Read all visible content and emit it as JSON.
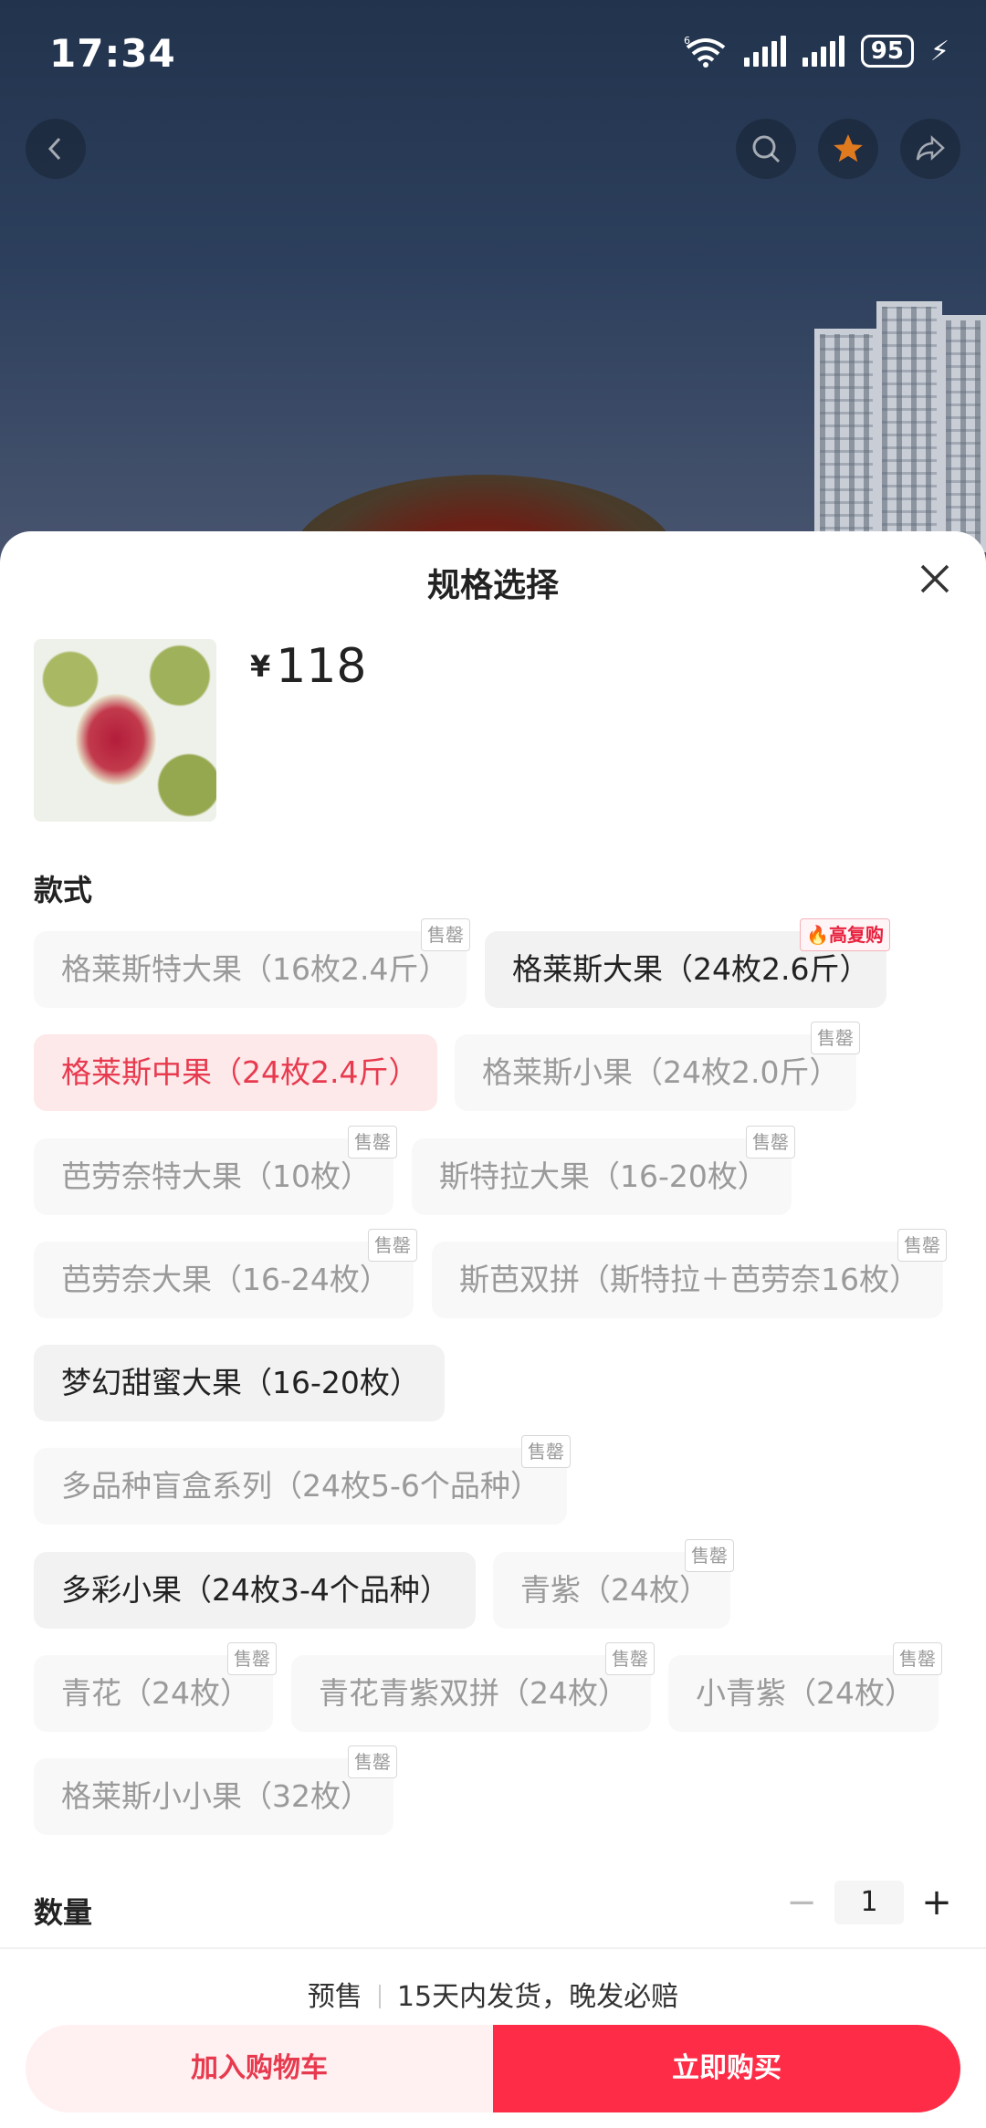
{
  "status_bar": {
    "time": "17:34",
    "battery": "95",
    "network": "6"
  },
  "sheet": {
    "title": "规格选择",
    "price_currency": "¥",
    "price": "118",
    "style_label": "款式",
    "quantity_label": "数量",
    "quantity_value": "1",
    "minus": "−",
    "plus": "+"
  },
  "options": [
    {
      "label": "格莱斯特大果（16枚2.4斤）",
      "state": "soldout",
      "tag": "售罄"
    },
    {
      "label": "格莱斯大果（24枚2.6斤）",
      "state": "available",
      "tag": "高复购"
    },
    {
      "label": "格莱斯中果（24枚2.4斤）",
      "state": "selected",
      "tag": ""
    },
    {
      "label": "格莱斯小果（24枚2.0斤）",
      "state": "soldout",
      "tag": "售罄"
    },
    {
      "label": "芭劳奈特大果（10枚）",
      "state": "soldout",
      "tag": "售罄"
    },
    {
      "label": "斯特拉大果（16-20枚）",
      "state": "soldout",
      "tag": "售罄"
    },
    {
      "label": "芭劳奈大果（16-24枚）",
      "state": "soldout",
      "tag": "售罄"
    },
    {
      "label": "斯芭双拼（斯特拉＋芭劳奈16枚）",
      "state": "soldout",
      "tag": "售罄"
    },
    {
      "label": "梦幻甜蜜大果（16-20枚）",
      "state": "available",
      "tag": ""
    },
    {
      "label": "多品种盲盒系列（24枚5-6个品种）",
      "state": "soldout",
      "tag": "售罄"
    },
    {
      "label": "多彩小果（24枚3-4个品种）",
      "state": "available",
      "tag": ""
    },
    {
      "label": "青紫（24枚）",
      "state": "soldout",
      "tag": "售罄"
    },
    {
      "label": "青花（24枚）",
      "state": "soldout",
      "tag": "售罄"
    },
    {
      "label": "青花青紫双拼（24枚）",
      "state": "soldout",
      "tag": "售罄"
    },
    {
      "label": "小青紫（24枚）",
      "state": "soldout",
      "tag": "售罄"
    },
    {
      "label": "格莱斯小小果（32枚）",
      "state": "soldout",
      "tag": "售罄"
    }
  ],
  "footer": {
    "presale": "预售",
    "shipping": "15天内发货，晚发必赔",
    "add_to_cart": "加入购物车",
    "buy_now": "立即购买"
  },
  "colors": {
    "accent": "#ff2c48",
    "selected_text": "#e83a4e",
    "selected_bg": "#fde8ea"
  }
}
